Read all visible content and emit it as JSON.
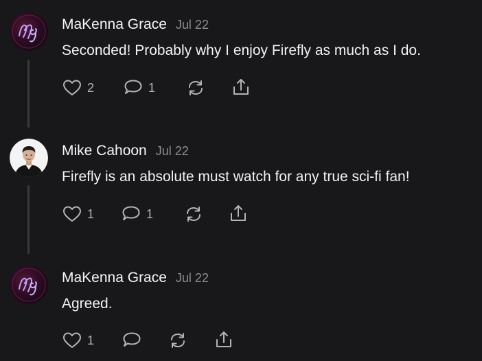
{
  "comments": [
    {
      "author": "MaKenna Grace",
      "date": "Jul 22",
      "text": "Seconded! Probably why I enjoy Firefly as much as I do.",
      "avatar": "monogram-mg",
      "likes": "2",
      "replies": "1"
    },
    {
      "author": "Mike Cahoon",
      "date": "Jul 22",
      "text": "Firefly is an absolute must watch for any true sci-fi fan!",
      "avatar": "profile-photo",
      "likes": "1",
      "replies": "1"
    },
    {
      "author": "MaKenna Grace",
      "date": "Jul 22",
      "text": "Agreed.",
      "avatar": "monogram-mg",
      "likes": "1",
      "replies": ""
    }
  ],
  "icons": {
    "like": "heart-icon",
    "reply": "speech-bubble-icon",
    "restack": "restack-icon",
    "share": "share-icon"
  },
  "colors": {
    "background": "#18181a",
    "text": "#f2f2f2",
    "muted": "#8d8d92",
    "icon": "#b4b4b8",
    "thread_line": "#3a3a3d"
  }
}
